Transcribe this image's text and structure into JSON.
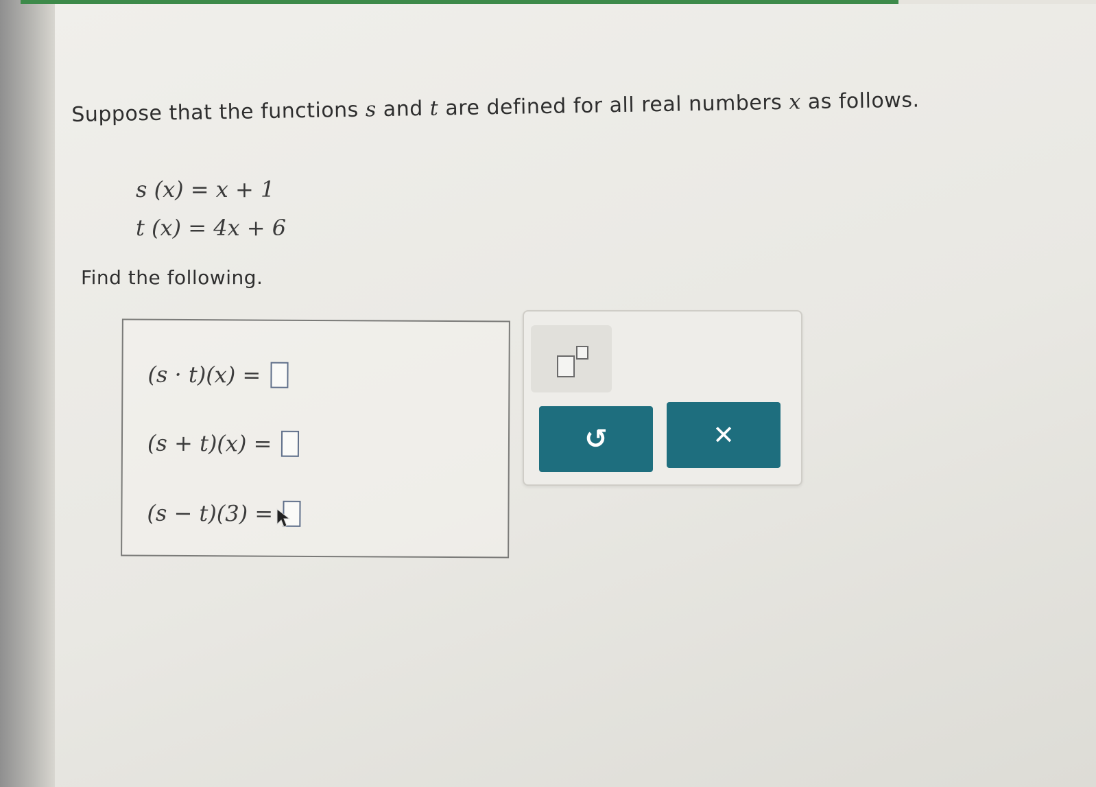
{
  "question": {
    "intro_prefix": "Suppose that the functions",
    "var_s": "s",
    "and_word": "and",
    "var_t": "t",
    "intro_middle": "are defined for all real numbers",
    "var_x": "x",
    "intro_suffix": "as follows."
  },
  "definitions": [
    {
      "name": "s",
      "arg": "(x)",
      "rhs": "= x + 1"
    },
    {
      "name": "t",
      "arg": "(x)",
      "rhs": "= 4x + 6"
    }
  ],
  "prompt": "Find the following.",
  "answers": [
    {
      "expr": "(s · t)(x) =",
      "value": ""
    },
    {
      "expr": "(s + t)(x) =",
      "value": ""
    },
    {
      "expr": "(s − t)(3) =",
      "value": ""
    }
  ],
  "toolbar": {
    "undo_glyph": "↺",
    "clear_glyph": "✕"
  },
  "colors": {
    "button": "#1e6e7e",
    "input_border": "#5f6f8a"
  }
}
